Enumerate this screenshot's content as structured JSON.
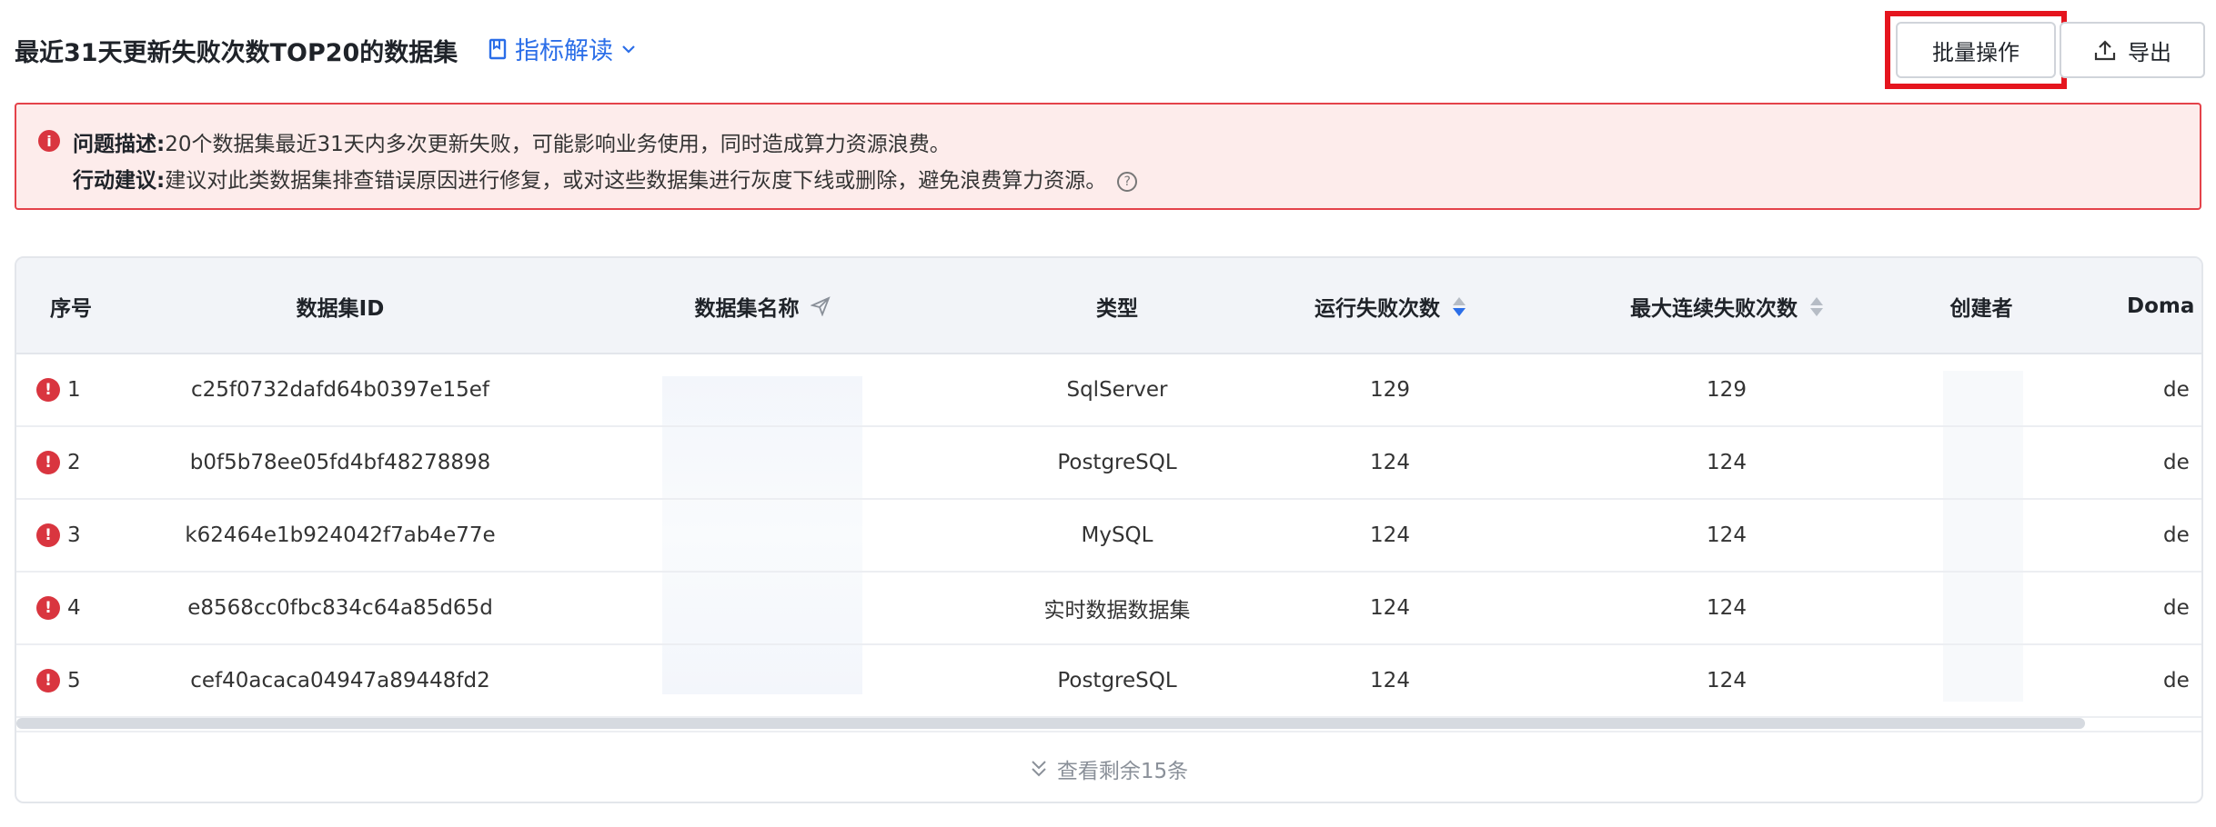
{
  "header": {
    "title": "最近31天更新失败次数TOP20的数据集",
    "metric_link": "指标解读",
    "batch_button": "批量操作",
    "export_button": "导出"
  },
  "alert": {
    "problem_label": "问题描述:",
    "problem_text": "20个数据集最近31天内多次更新失败，可能影响业务使用，同时造成算力资源浪费。",
    "action_label": "行动建议:",
    "action_text": "建议对此类数据集排查错误原因进行修复，或对这些数据集进行灰度下线或删除，避免浪费算力资源。"
  },
  "table": {
    "columns": {
      "index": "序号",
      "dataset_id": "数据集ID",
      "dataset_name": "数据集名称",
      "type": "类型",
      "run_failures": "运行失败次数",
      "max_consecutive": "最大连续失败次数",
      "creator": "创建者",
      "domain": "Doma"
    },
    "rows": [
      {
        "index": "1",
        "id": "c25f0732dafd64b0397e15ef",
        "type": "SqlServer",
        "failures": "129",
        "max_consecutive": "129",
        "domain": "de"
      },
      {
        "index": "2",
        "id": "b0f5b78ee05fd4bf48278898",
        "type": "PostgreSQL",
        "failures": "124",
        "max_consecutive": "124",
        "domain": "de"
      },
      {
        "index": "3",
        "id": "k62464e1b924042f7ab4e77e",
        "type": "MySQL",
        "failures": "124",
        "max_consecutive": "124",
        "domain": "de"
      },
      {
        "index": "4",
        "id": "e8568cc0fbc834c64a85d65d",
        "type": "实时数据数据集",
        "failures": "124",
        "max_consecutive": "124",
        "domain": "de"
      },
      {
        "index": "5",
        "id": "cef40acaca04947a89448fd2",
        "type": "PostgreSQL",
        "failures": "124",
        "max_consecutive": "124",
        "domain": "de"
      }
    ],
    "show_more": "查看剩余15条"
  },
  "colors": {
    "accent": "#2b6ee8",
    "error": "#d9353f",
    "highlight_frame": "#e5151e"
  }
}
